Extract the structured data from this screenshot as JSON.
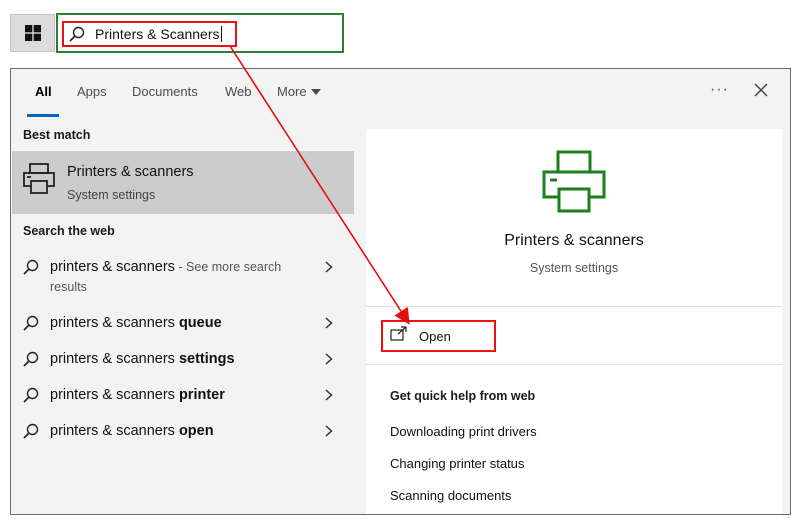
{
  "search": {
    "value": "Printers & Scanners"
  },
  "tabs": [
    {
      "label": "All"
    },
    {
      "label": "Apps"
    },
    {
      "label": "Documents"
    },
    {
      "label": "Web"
    },
    {
      "label": "More"
    }
  ],
  "ellipsis": "···",
  "best_match": {
    "heading": "Best match",
    "title": "Printers & scanners",
    "subtitle": "System settings"
  },
  "web": {
    "heading": "Search the web",
    "items": [
      {
        "prefix": "printers & scanners",
        "suffix": "",
        "more": " - See more search results"
      },
      {
        "prefix": "printers & scanners ",
        "suffix": "queue",
        "more": ""
      },
      {
        "prefix": "printers & scanners ",
        "suffix": "settings",
        "more": ""
      },
      {
        "prefix": "printers & scanners ",
        "suffix": "printer",
        "more": ""
      },
      {
        "prefix": "printers & scanners ",
        "suffix": "open",
        "more": ""
      }
    ]
  },
  "preview": {
    "title": "Printers & scanners",
    "subtitle": "System settings",
    "open_label": "Open",
    "help_heading": "Get quick help from web",
    "help_links": [
      "Downloading print drivers",
      "Changing printer status",
      "Scanning documents"
    ]
  },
  "colors": {
    "accent": "#0067c0",
    "annotation": "#e11111",
    "icon_green": "#1b7f1b",
    "search_border": "#2e7d32"
  }
}
